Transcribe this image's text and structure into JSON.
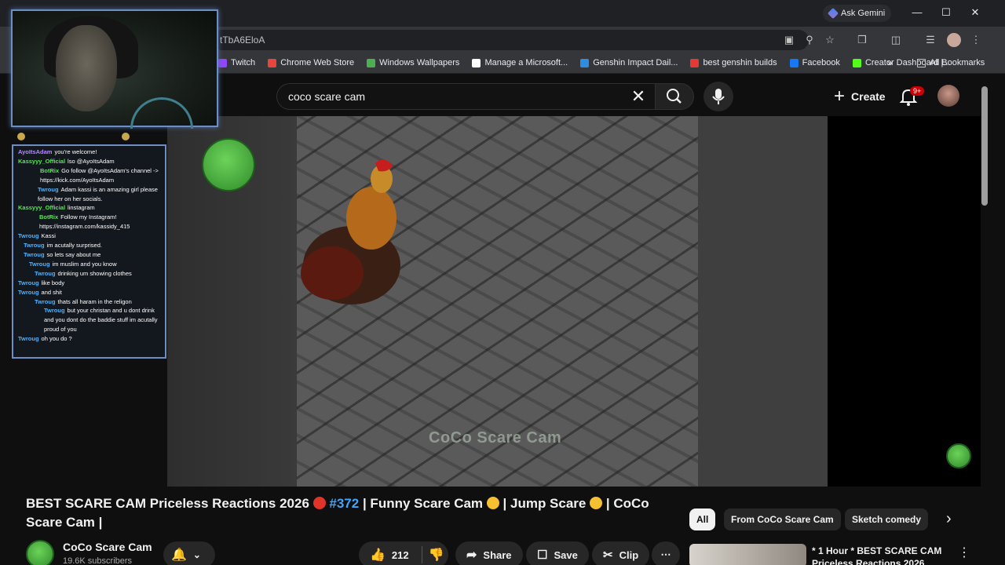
{
  "browser": {
    "ask_gemini": "Ask Gemini",
    "url": "tTbA6EloA",
    "bookmarks": [
      {
        "label": "Twitch",
        "color": "#9146ff"
      },
      {
        "label": "Chrome Web Store",
        "color": "#e8453c"
      },
      {
        "label": "Windows Wallpapers",
        "color": "#4caf50"
      },
      {
        "label": "Manage a Microsoft...",
        "color": "#ffffff"
      },
      {
        "label": "Genshin Impact Dail...",
        "color": "#2f8ce0"
      },
      {
        "label": "best genshin builds",
        "color": "#e53935"
      },
      {
        "label": "Facebook",
        "color": "#1877f2"
      },
      {
        "label": "Creator Dashboard |...",
        "color": "#53fc18"
      }
    ],
    "all_bookmarks": "All Bookmarks"
  },
  "youtube": {
    "search_value": "coco scare cam",
    "create_label": "Create",
    "notif_count": "9+"
  },
  "overlay": {
    "chat": [
      {
        "user": "AyoItsAdam",
        "text": "you're welcome!",
        "color": "#b18cff",
        "indent": 0
      },
      {
        "user": "Kassyyy_Official",
        "text": "lso @AyoItsAdam",
        "color": "#59e659",
        "indent": 0
      },
      {
        "user": "BotRix",
        "text": "Go follow @AyoItsAdam's channel -> https://kick.com/AyoItsAdam",
        "color": "#59e659",
        "indent": 28
      },
      {
        "user": "Twroug",
        "text": "Adam kassi is an amazing girl please follow her on her socials.",
        "color": "#4fb3ff",
        "indent": 25
      },
      {
        "user": "Kassyyy_Official",
        "text": "linstagram",
        "color": "#59e659",
        "indent": 0
      },
      {
        "user": "BotRix",
        "text": "Follow my Instagram! https://instagram.com/kassidy_415",
        "color": "#59e659",
        "indent": 27
      },
      {
        "user": "Twroug",
        "text": "Kassi",
        "color": "#4fb3ff",
        "indent": 0
      },
      {
        "user": "Twroug",
        "text": "im acutally surprised.",
        "color": "#4fb3ff",
        "indent": 7
      },
      {
        "user": "Twroug",
        "text": "so lets say about me",
        "color": "#4fb3ff",
        "indent": 7
      },
      {
        "user": "Twroug",
        "text": "im muslim and you know",
        "color": "#4fb3ff",
        "indent": 14
      },
      {
        "user": "Twroug",
        "text": "drinking um showing clothes",
        "color": "#4fb3ff",
        "indent": 21
      },
      {
        "user": "Twroug",
        "text": "like body",
        "color": "#4fb3ff",
        "indent": 0
      },
      {
        "user": "Twroug",
        "text": "and shit",
        "color": "#4fb3ff",
        "indent": 0
      },
      {
        "user": "Twroug",
        "text": "thats all haram in the religon",
        "color": "#4fb3ff",
        "indent": 21
      },
      {
        "user": "Twroug",
        "text": "but your christan and u dont drink and you dont do the baddie stuff im acutally proud of you",
        "color": "#4fb3ff",
        "indent": 33
      },
      {
        "user": "Twroug",
        "text": "oh you do ?",
        "color": "#4fb3ff",
        "indent": 0
      }
    ]
  },
  "video": {
    "watermark": "CoCo Scare Cam",
    "title_part1": "BEST SCARE CAM Priceless Reactions 2026",
    "hashtag": "#372",
    "title_part2": "| Funny Scare Cam",
    "title_part3": "| Jump Scare",
    "title_part4": "| CoCo Scare Cam |",
    "channel_name": "CoCo Scare Cam",
    "subscribers": "19.6K subscribers",
    "likes": "212",
    "share_label": "Share",
    "save_label": "Save",
    "clip_label": "Clip"
  },
  "sidebar": {
    "chips": [
      "All",
      "From CoCo Scare Cam",
      "Sketch comedy"
    ],
    "rec_title": "* 1 Hour * BEST SCARE CAM Priceless Reactions 2026"
  }
}
